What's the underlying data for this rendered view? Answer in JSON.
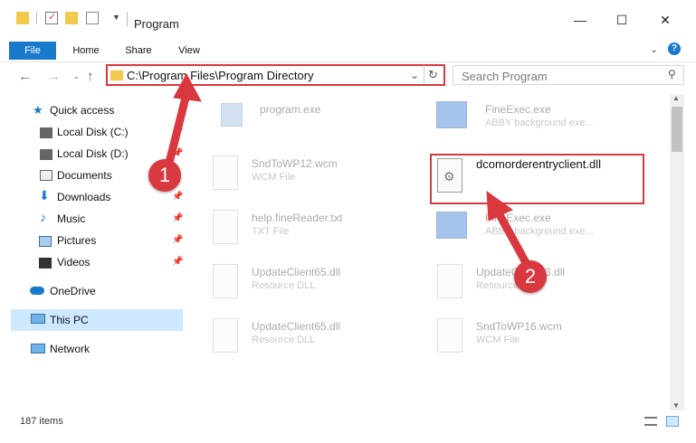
{
  "window": {
    "title": "Program"
  },
  "ribbon": {
    "tabs": [
      "File",
      "Home",
      "Share",
      "View"
    ]
  },
  "address": {
    "path": "C:\\Program Files\\Program Directory"
  },
  "search": {
    "placeholder": "Search Program"
  },
  "sidebar": {
    "quick_access": "Quick access",
    "items": [
      {
        "label": "Local Disk (C:)",
        "icon": "drive-icon"
      },
      {
        "label": "Local Disk (D:)",
        "icon": "drive-icon"
      },
      {
        "label": "Documents",
        "icon": "documents-icon"
      },
      {
        "label": "Downloads",
        "icon": "downloads-icon"
      },
      {
        "label": "Music",
        "icon": "music-icon"
      },
      {
        "label": "Pictures",
        "icon": "pictures-icon"
      },
      {
        "label": "Videos",
        "icon": "videos-icon"
      }
    ],
    "onedrive": "OneDrive",
    "this_pc": "This PC",
    "network": "Network"
  },
  "files": [
    {
      "name": "program.exe",
      "type": ""
    },
    {
      "name": "FineExec.exe",
      "type": "ABBY background exe..."
    },
    {
      "name": "SndToWP12.wcm",
      "type": "WCM File"
    },
    {
      "name": "dcomorderentryclient.dll",
      "type": ""
    },
    {
      "name": "help.fineReader.txt",
      "type": "TXT File"
    },
    {
      "name": "FineExec.exe",
      "type": "ABBY background exe..."
    },
    {
      "name": "UpdateClient65.dll",
      "type": "Resource DLL"
    },
    {
      "name": "UpdateClient63.dll",
      "type": "Resource DLL"
    },
    {
      "name": "UpdateClient65.dll",
      "type": "Resource DLL"
    },
    {
      "name": "SndToWP16.wcm",
      "type": "WCM File"
    }
  ],
  "status": {
    "count": "187 items"
  },
  "annotations": {
    "step1": "1",
    "step2": "2"
  },
  "colors": {
    "accent": "#1979ca",
    "highlight": "#d9383e",
    "selection": "#cde8ff"
  }
}
